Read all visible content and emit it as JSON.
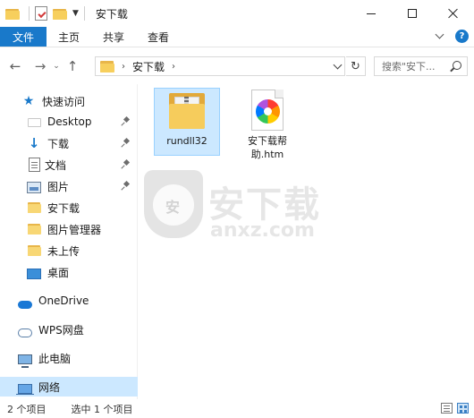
{
  "window": {
    "title": "安下载"
  },
  "ribbon": {
    "tabs": [
      "文件",
      "主页",
      "共享",
      "查看"
    ],
    "help_label": "?"
  },
  "address": {
    "crumb": "安下载",
    "search_placeholder": "搜索\"安下..."
  },
  "sidebar": {
    "quick_access": "快速访问",
    "items": [
      {
        "label": "Desktop",
        "icon": "folder-icon",
        "pinned": true
      },
      {
        "label": "下载",
        "icon": "download-icon",
        "pinned": true
      },
      {
        "label": "文档",
        "icon": "document-icon",
        "pinned": true
      },
      {
        "label": "图片",
        "icon": "pictures-icon",
        "pinned": true
      },
      {
        "label": "安下载",
        "icon": "folder-icon",
        "pinned": false
      },
      {
        "label": "图片管理器",
        "icon": "folder-icon",
        "pinned": false
      },
      {
        "label": "未上传",
        "icon": "folder-icon",
        "pinned": false
      },
      {
        "label": "桌面",
        "icon": "desktop-icon",
        "pinned": false
      }
    ],
    "onedrive": "OneDrive",
    "wps": "WPS网盘",
    "this_pc": "此电脑",
    "network": "网络"
  },
  "files": [
    {
      "name": "rundll32",
      "type": "folder",
      "selected": true
    },
    {
      "name": "安下载帮助.htm",
      "name_line1": "安下载帮",
      "name_line2": "助.htm",
      "type": "htm",
      "selected": false
    }
  ],
  "watermark": {
    "shield_char": "安",
    "text": "安下载",
    "url": "anxz.com"
  },
  "status": {
    "item_count": "2 个项目",
    "selected": "选中 1 个项目"
  },
  "colors": {
    "accent": "#1979ca",
    "selection": "#cce8ff",
    "folder": "#f6cc5c"
  }
}
